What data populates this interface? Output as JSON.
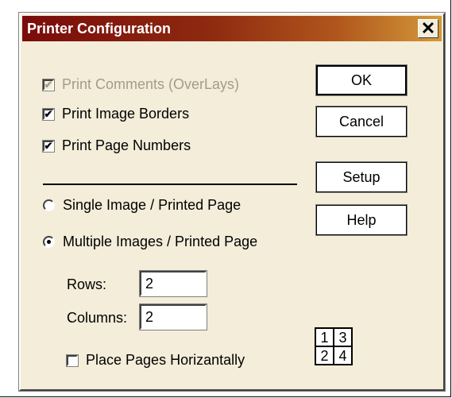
{
  "dialog": {
    "title": "Printer Configuration",
    "close_glyph": "✕"
  },
  "options": {
    "print_comments": {
      "label": "Print Comments (OverLays)",
      "checked": true,
      "disabled": true
    },
    "print_borders": {
      "label": "Print Image Borders",
      "checked": true
    },
    "print_page_numbers": {
      "label": "Print Page Numbers",
      "checked": true
    }
  },
  "layout": {
    "single": {
      "label": "Single Image / Printed Page",
      "selected": false
    },
    "multiple": {
      "label": "Multiple Images / Printed Page",
      "selected": true
    }
  },
  "rows": {
    "label": "Rows:",
    "value": "2"
  },
  "columns": {
    "label": "Columns:",
    "value": "2"
  },
  "place_horizontal": {
    "label": "Place Pages Horizantally",
    "checked": false
  },
  "buttons": {
    "ok": "OK",
    "cancel": "Cancel",
    "setup": "Setup",
    "help": "Help"
  },
  "page_order_preview": [
    "1",
    "3",
    "2",
    "4"
  ],
  "check_glyph": "✔",
  "colors": {
    "dialog_bg": "#f3edd9",
    "title_start": "#7a0b0b",
    "title_end": "#d49a3a",
    "disabled_text": "#a59c84"
  }
}
